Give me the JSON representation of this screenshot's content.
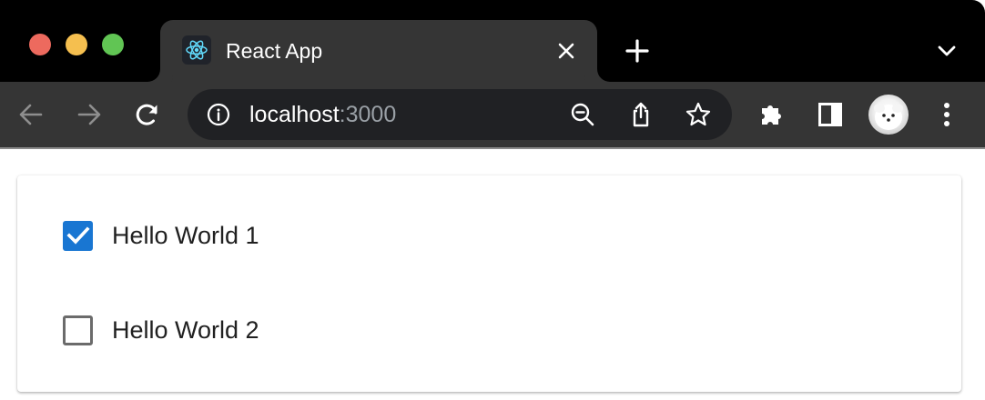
{
  "browser": {
    "tab": {
      "title": "React App",
      "favicon": "react-logo-icon",
      "close_icon": "close-icon"
    },
    "new_tab_icon": "plus-icon",
    "tab_search_icon": "chevron-down-icon",
    "toolbar": {
      "back_icon": "arrow-left-icon",
      "forward_icon": "arrow-right-icon",
      "reload_icon": "reload-icon",
      "site_info_icon": "info-icon",
      "url_host": "localhost",
      "url_port": ":3000",
      "zoom_icon": "zoom-out-icon",
      "share_icon": "share-icon",
      "bookmark_icon": "star-icon",
      "extensions_icon": "puzzle-icon",
      "side_panel_icon": "side-panel-icon",
      "profile_icon": "avatar",
      "menu_icon": "more-vertical-icon"
    },
    "colors": {
      "traffic_red": "#ed6a5e",
      "traffic_yellow": "#f5bf4f",
      "traffic_green": "#61c554"
    }
  },
  "page": {
    "items": [
      {
        "label": "Hello World 1",
        "checked": true
      },
      {
        "label": "Hello World 2",
        "checked": false
      }
    ],
    "colors": {
      "checkbox_checked": "#1976d2",
      "checkbox_border": "#6b6b6b"
    }
  }
}
